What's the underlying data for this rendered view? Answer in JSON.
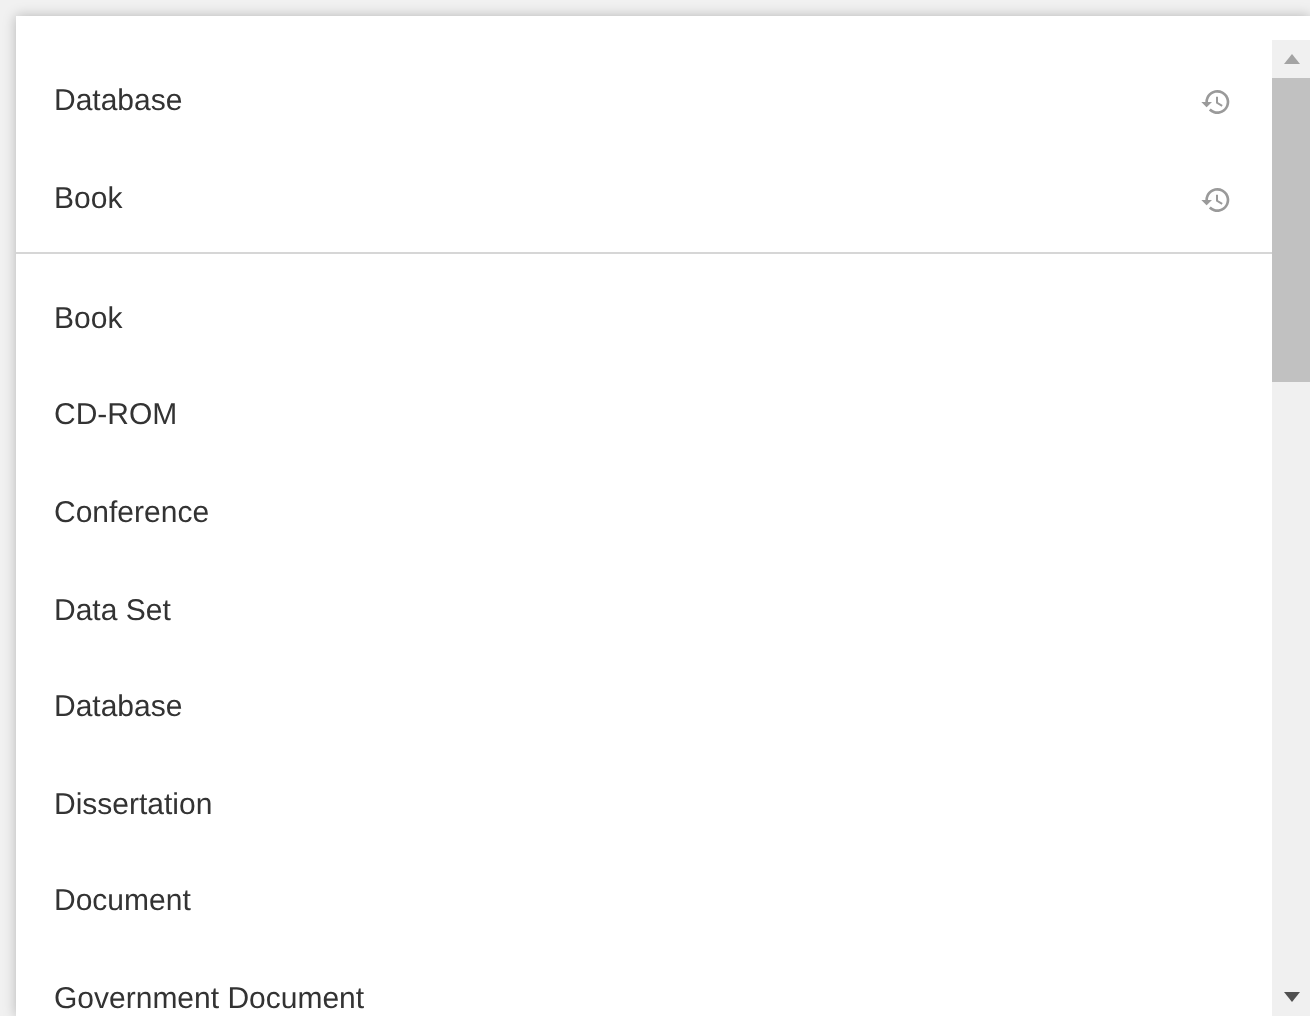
{
  "recent_items": [
    {
      "label": "Database"
    },
    {
      "label": "Book"
    }
  ],
  "options": [
    {
      "label": "Book"
    },
    {
      "label": "CD-ROM"
    },
    {
      "label": "Conference"
    },
    {
      "label": "Data Set"
    },
    {
      "label": "Database"
    },
    {
      "label": "Dissertation"
    },
    {
      "label": "Document"
    },
    {
      "label": "Government Document"
    }
  ]
}
